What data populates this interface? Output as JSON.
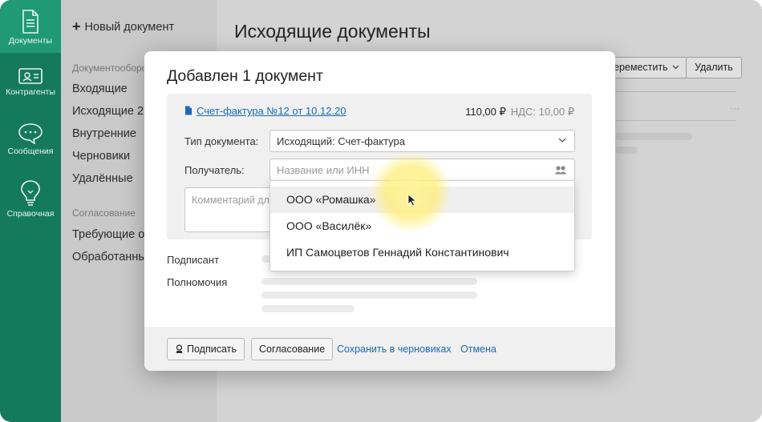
{
  "rail": {
    "items": [
      {
        "label": "Документы",
        "icon": "document-icon"
      },
      {
        "label": "Контрагенты",
        "icon": "contact-card-icon"
      },
      {
        "label": "Сообщения",
        "icon": "chat-bubble-icon"
      },
      {
        "label": "Справочная",
        "icon": "lightbulb-icon"
      }
    ]
  },
  "sidebar": {
    "new_document": "Новый документ",
    "group_docflow": "Документооборот",
    "items": [
      "Входящие",
      "Исходящие 2",
      "Внутренние",
      "Черновики",
      "Удалённые"
    ],
    "group_approval": "Согласование",
    "approval_items": [
      "Требующие о",
      "Обработанны"
    ]
  },
  "main": {
    "title": "Исходящие документы",
    "move_button": "ереместить",
    "delete_button": "Удалить"
  },
  "modal": {
    "title": "Добавлен 1 документ",
    "doc_link": "Счет-фактура №12 от 10.12.20",
    "amount": "110,00 ₽",
    "vat": "НДС: 10,00 ₽",
    "doc_type_label": "Тип документа:",
    "doc_type_value": "Исходящий: Счет-фактура",
    "recipient_label": "Получатель:",
    "recipient_placeholder": "Название или ИНН",
    "comment_placeholder": "Комментарий для",
    "signer_label": "Подписант",
    "authority_label": "Полномочия",
    "sign_button": "Подписать",
    "approval_button": "Согласование",
    "save_draft_link": "Сохранить в черновиках",
    "cancel_link": "Отмена"
  },
  "dropdown": {
    "options": [
      "ООО «Ромашка»",
      "ООО «Василёк»",
      "ИП Самоцветов Геннадий Константинович"
    ]
  },
  "colors": {
    "rail": "#157a5c",
    "rail_active": "#1f9a74",
    "link": "#1a6ab5"
  }
}
